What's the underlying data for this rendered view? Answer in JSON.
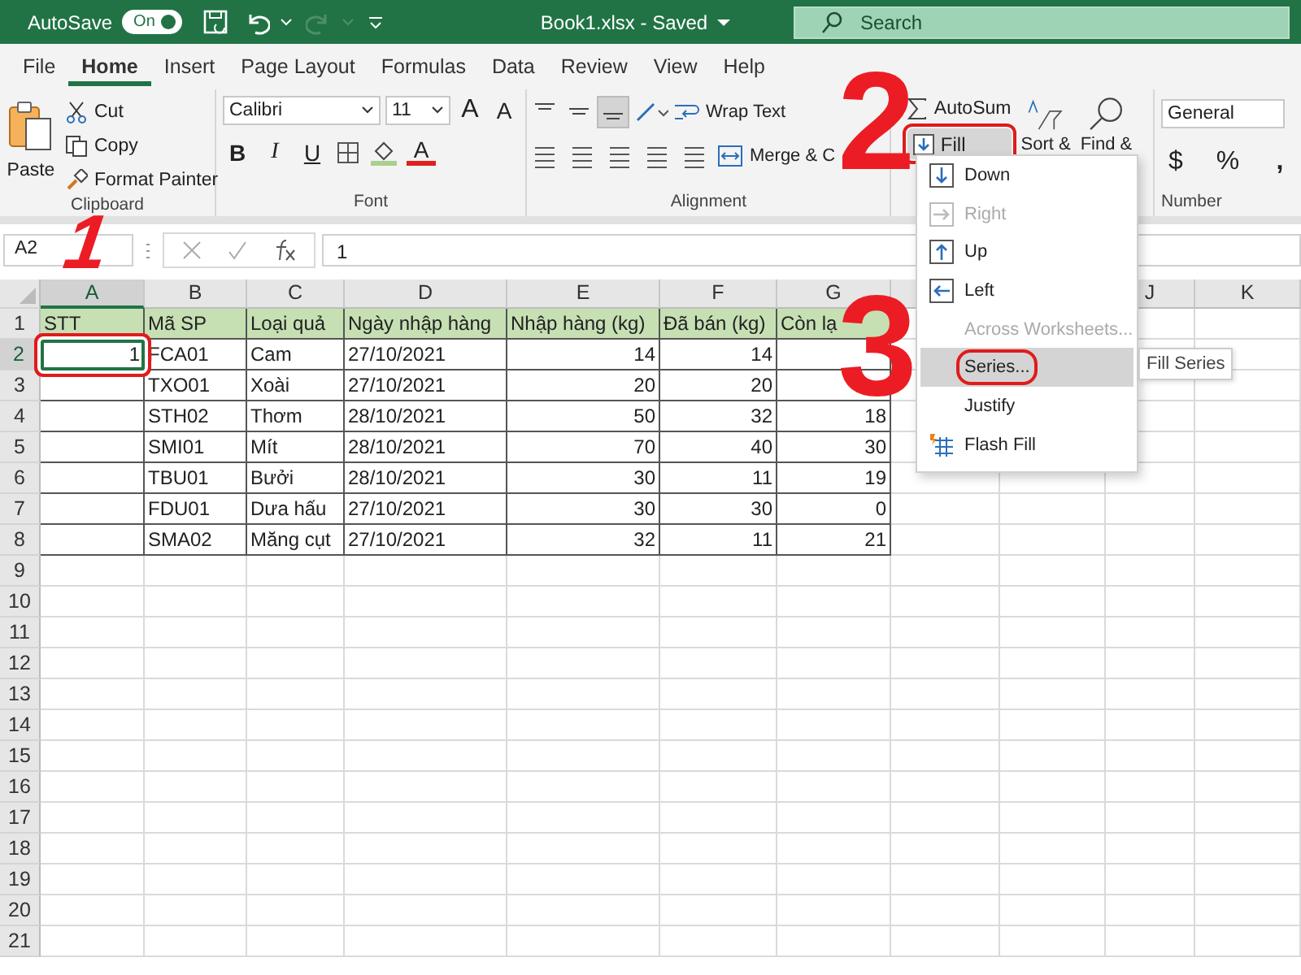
{
  "title_bar": {
    "autosave_label": "AutoSave",
    "autosave_toggle": {
      "label": "On",
      "on": true
    },
    "redo_disabled": true,
    "document_title": "Book1.xlsx - Saved",
    "search": {
      "placeholder": "Search"
    }
  },
  "ribbon_tabs": [
    {
      "label": "File",
      "selected": false
    },
    {
      "label": "Home",
      "selected": true
    },
    {
      "label": "Insert",
      "selected": false
    },
    {
      "label": "Page Layout",
      "selected": false
    },
    {
      "label": "Formulas",
      "selected": false
    },
    {
      "label": "Data",
      "selected": false
    },
    {
      "label": "Review",
      "selected": false
    },
    {
      "label": "View",
      "selected": false
    },
    {
      "label": "Help",
      "selected": false
    }
  ],
  "ribbon": {
    "clipboard": {
      "paste": "Paste",
      "cut": "Cut",
      "copy": "Copy",
      "format_painter": "Format Painter",
      "label": "Clipboard"
    },
    "font": {
      "font_name": "Calibri",
      "font_size": "11",
      "grow": "A",
      "shrink": "A",
      "bold": "B",
      "italic": "I",
      "underline": "U",
      "font_color": "A",
      "label": "Font"
    },
    "alignment": {
      "wrap_text": "Wrap Text",
      "merge": "Merge & C",
      "label": "Alignment"
    },
    "editing": {
      "autosum": "AutoSum",
      "fill": {
        "label": "Fill",
        "highlighted": true
      },
      "sort": "Sort &",
      "find": "Find &"
    },
    "number": {
      "format": "General",
      "currency": "$",
      "percent": "%",
      "comma": ",",
      "label": "Number"
    }
  },
  "formula_bar": {
    "name_box": "A2",
    "formula": "1"
  },
  "sheet": {
    "columns": [
      {
        "letter": "A",
        "numeric": true,
        "selected": true
      },
      {
        "letter": "B",
        "numeric": false,
        "selected": false
      },
      {
        "letter": "C",
        "numeric": false,
        "selected": false
      },
      {
        "letter": "D",
        "numeric": false,
        "selected": false
      },
      {
        "letter": "E",
        "numeric": true,
        "selected": false
      },
      {
        "letter": "F",
        "numeric": true,
        "selected": false
      },
      {
        "letter": "G",
        "numeric": true,
        "selected": false
      }
    ],
    "right_columns": [
      {
        "letter": "J",
        "selected": false
      },
      {
        "letter": "K",
        "selected": false
      }
    ],
    "rows": [
      {
        "number": "1",
        "header": true,
        "selected": false,
        "cells": [
          "STT",
          "Mã SP",
          "Loại quả",
          "Ngày nhập hàng",
          "Nhập hàng (kg)",
          "Đã bán (kg)",
          "Còn lạ"
        ]
      },
      {
        "number": "2",
        "header": false,
        "selected": true,
        "cells": [
          {
            "text": "1",
            "selected": true,
            "highlighted": true
          },
          "FCA01",
          "Cam",
          "27/10/2021",
          "14",
          "14",
          null
        ]
      },
      {
        "number": "3",
        "header": false,
        "selected": false,
        "cells": [
          null,
          "TXO01",
          "Xoài",
          "27/10/2021",
          "20",
          "20",
          null
        ]
      },
      {
        "number": "4",
        "header": false,
        "selected": false,
        "cells": [
          null,
          "STH02",
          "Thơm",
          "28/10/2021",
          "50",
          "32",
          "18"
        ]
      },
      {
        "number": "5",
        "header": false,
        "selected": false,
        "cells": [
          null,
          "SMI01",
          "Mít",
          "28/10/2021",
          "70",
          "40",
          "30"
        ]
      },
      {
        "number": "6",
        "header": false,
        "selected": false,
        "cells": [
          null,
          "TBU01",
          "Bưởi",
          "28/10/2021",
          "30",
          "11",
          "19"
        ]
      },
      {
        "number": "7",
        "header": false,
        "selected": false,
        "cells": [
          null,
          "FDU01",
          "Dưa hấu",
          "27/10/2021",
          "30",
          "30",
          "0"
        ]
      },
      {
        "number": "8",
        "header": false,
        "selected": false,
        "cells": [
          null,
          "SMA02",
          "Măng cụt",
          "27/10/2021",
          "32",
          "11",
          "21"
        ]
      },
      {
        "number": "9"
      },
      {
        "number": "10"
      },
      {
        "number": "11"
      },
      {
        "number": "12"
      },
      {
        "number": "13"
      },
      {
        "number": "14"
      },
      {
        "number": "15"
      },
      {
        "number": "16"
      },
      {
        "number": "17"
      },
      {
        "number": "18"
      },
      {
        "number": "19"
      },
      {
        "number": "20"
      },
      {
        "number": "21"
      }
    ]
  },
  "fill_menu": {
    "items": [
      {
        "label": "Down",
        "kind": "down",
        "disabled": false,
        "hovered": false,
        "highlighted": false
      },
      {
        "label": "Right",
        "kind": "right",
        "disabled": true,
        "hovered": false,
        "highlighted": false
      },
      {
        "label": "Up",
        "kind": "up",
        "disabled": false,
        "hovered": false,
        "highlighted": false
      },
      {
        "label": "Left",
        "kind": "left",
        "disabled": false,
        "hovered": false,
        "highlighted": false
      },
      {
        "label": "Across Worksheets...",
        "kind": "none",
        "disabled": true,
        "hovered": false,
        "highlighted": false
      },
      {
        "label": "Series...",
        "kind": "none",
        "disabled": false,
        "hovered": true,
        "highlighted": true
      },
      {
        "label": "Justify",
        "kind": "none",
        "disabled": false,
        "hovered": false,
        "highlighted": false
      },
      {
        "label": "Flash Fill",
        "kind": "flash",
        "disabled": false,
        "hovered": false,
        "highlighted": false
      }
    ]
  },
  "tooltip": "Fill Series",
  "annotations": [
    {
      "label": "1",
      "kind": "cell"
    },
    {
      "label": "2",
      "kind": "ribbon"
    },
    {
      "label": "3",
      "kind": "menu"
    }
  ]
}
